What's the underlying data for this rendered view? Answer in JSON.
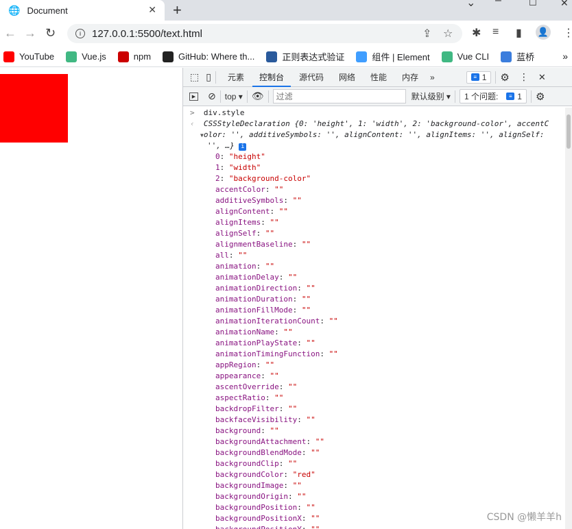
{
  "browser": {
    "tab_title": "Document",
    "url": "127.0.0.1:5500/text.html"
  },
  "bookmarks": [
    {
      "label": "YouTube",
      "icon": "youtube-icon",
      "color": "#ff0000"
    },
    {
      "label": "Vue.js",
      "icon": "vue-icon",
      "color": "#41b883"
    },
    {
      "label": "npm",
      "icon": "npm-icon",
      "color": "#cb0000"
    },
    {
      "label": "GitHub: Where th...",
      "icon": "github-icon",
      "color": "#222222"
    },
    {
      "label": "正则表达式验证",
      "icon": "regex-icon",
      "color": "#2a5a9c"
    },
    {
      "label": "组件 | Element",
      "icon": "element-icon",
      "color": "#409eff"
    },
    {
      "label": "Vue CLI",
      "icon": "vue-icon",
      "color": "#41b883"
    },
    {
      "label": "蓝桥",
      "icon": "lanqiao-icon",
      "color": "#3b7ddd"
    }
  ],
  "devtools": {
    "tabs": [
      "元素",
      "控制台",
      "源代码",
      "网络",
      "性能",
      "内存"
    ],
    "active_tab": "控制台",
    "message_count": "1",
    "context": "top",
    "filter_placeholder": "过滤",
    "level": "默认级别",
    "issues_label": "1 个问题:",
    "issues_count": "1"
  },
  "console": {
    "input": "div.style",
    "summary_1": "CSSStyleDeclaration {0: 'height', 1: 'width', 2: 'background-color', accentC",
    "summary_2": "olor: '', additiveSymbols: '', alignContent: '', alignItems: '', alignSelf:",
    "summary_3": "'', …}",
    "properties": [
      [
        "0",
        "\"height\""
      ],
      [
        "1",
        "\"width\""
      ],
      [
        "2",
        "\"background-color\""
      ],
      [
        "accentColor",
        "\"\""
      ],
      [
        "additiveSymbols",
        "\"\""
      ],
      [
        "alignContent",
        "\"\""
      ],
      [
        "alignItems",
        "\"\""
      ],
      [
        "alignSelf",
        "\"\""
      ],
      [
        "alignmentBaseline",
        "\"\""
      ],
      [
        "all",
        "\"\""
      ],
      [
        "animation",
        "\"\""
      ],
      [
        "animationDelay",
        "\"\""
      ],
      [
        "animationDirection",
        "\"\""
      ],
      [
        "animationDuration",
        "\"\""
      ],
      [
        "animationFillMode",
        "\"\""
      ],
      [
        "animationIterationCount",
        "\"\""
      ],
      [
        "animationName",
        "\"\""
      ],
      [
        "animationPlayState",
        "\"\""
      ],
      [
        "animationTimingFunction",
        "\"\""
      ],
      [
        "appRegion",
        "\"\""
      ],
      [
        "appearance",
        "\"\""
      ],
      [
        "ascentOverride",
        "\"\""
      ],
      [
        "aspectRatio",
        "\"\""
      ],
      [
        "backdropFilter",
        "\"\""
      ],
      [
        "backfaceVisibility",
        "\"\""
      ],
      [
        "background",
        "\"\""
      ],
      [
        "backgroundAttachment",
        "\"\""
      ],
      [
        "backgroundBlendMode",
        "\"\""
      ],
      [
        "backgroundClip",
        "\"\""
      ],
      [
        "backgroundColor",
        "\"red\""
      ],
      [
        "backgroundImage",
        "\"\""
      ],
      [
        "backgroundOrigin",
        "\"\""
      ],
      [
        "backgroundPosition",
        "\"\""
      ],
      [
        "backgroundPositionX",
        "\"\""
      ],
      [
        "backgroundPositionY",
        "\"\""
      ]
    ]
  },
  "watermark": "CSDN @懒羊羊h"
}
